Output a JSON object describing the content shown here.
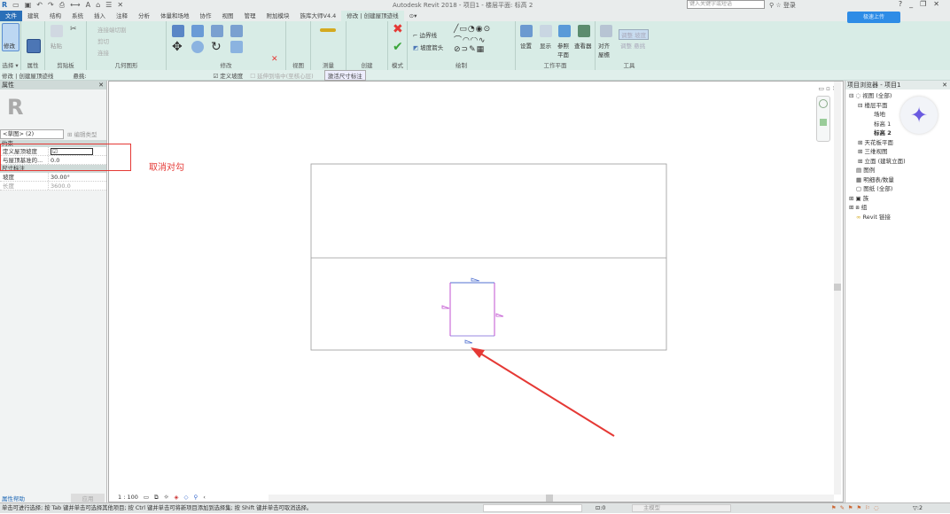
{
  "window": {
    "title": "Autodesk Revit 2018 -   项目1 - 楼层平面: 标高 2",
    "search_placeholder": "键入关键字或短语",
    "login": "登录"
  },
  "tabs": [
    "文件",
    "建筑",
    "结构",
    "系统",
    "插入",
    "注释",
    "分析",
    "体量和场地",
    "协作",
    "视图",
    "管理",
    "附加模块",
    "族库大师V4.4",
    "修改 | 创建屋顶迹线"
  ],
  "active_tab": "修改 | 创建屋顶迹线",
  "ribbon": {
    "panels": [
      "选择 ▾",
      "属性",
      "剪贴板",
      "几何图形",
      "修改",
      "视图",
      "测量",
      "创建",
      "模式",
      "绘制",
      "工作平面",
      "工具"
    ],
    "modify_label": "修改",
    "paste_label": "粘贴",
    "geometry": [
      "连接端切割",
      "剪切",
      "连接"
    ],
    "boundary_line": "边界线",
    "slope_arrow": "坡度箭头",
    "workplane": [
      "设置",
      "显示",
      "参照平面",
      "查看器"
    ],
    "tools": [
      "对齐屋檐",
      "调整 坡度",
      "调整 悬挑"
    ]
  },
  "upload_button": "极速上传",
  "options_bar": {
    "context": "修改 | 创建屋顶迹线",
    "overhang_label": "悬挑:",
    "define_slope": "定义坡度",
    "define_slope_checked": true,
    "extend_to_core": "延伸到墙中(至核心层)",
    "extend_checked": false,
    "activate_dims": "激活尺寸标注"
  },
  "properties": {
    "title": "属性",
    "type_selector": "<草图> (2)",
    "edit_type": "编辑类型",
    "groups": [
      {
        "name": "约束",
        "rows": [
          {
            "key": "定义屋顶坡度",
            "value": "",
            "checked": true
          },
          {
            "key": "与屋顶基准的...",
            "value": "0.0"
          }
        ]
      },
      {
        "name": "尺寸标注",
        "rows": [
          {
            "key": "坡度",
            "value": "30.00°"
          },
          {
            "key": "长度",
            "value": "3600.0"
          }
        ]
      }
    ],
    "help_link": "属性帮助",
    "apply": "应用"
  },
  "annotation": {
    "text": "取消对勾",
    "color": "#e53935"
  },
  "browser": {
    "title": "项目浏览器 - 项目1",
    "items": [
      {
        "label": "视图 (全部)",
        "level": 0
      },
      {
        "label": "楼层平面",
        "level": 1
      },
      {
        "label": "场地",
        "level": 2
      },
      {
        "label": "标高 1",
        "level": 2
      },
      {
        "label": "标高 2",
        "level": 2,
        "selected": true
      },
      {
        "label": "天花板平面",
        "level": 1
      },
      {
        "label": "三维视图",
        "level": 1
      },
      {
        "label": "立面 (建筑立面)",
        "level": 1
      },
      {
        "label": "图例",
        "level": 0
      },
      {
        "label": "明细表/数量",
        "level": 0
      },
      {
        "label": "图纸 (全部)",
        "level": 0
      },
      {
        "label": "族",
        "level": 0
      },
      {
        "label": "组",
        "level": 0
      },
      {
        "label": "Revit 链接",
        "level": 0
      }
    ]
  },
  "view_bar": {
    "scale": "1 : 100"
  },
  "status": {
    "message": "单击可进行选择; 按 Tab 键并单击可选择其他项目; 按 Ctrl 键并单击可将新项目添加到选择集; 按 Shift 键并单击可取消选择。",
    "count": ":0",
    "model": "主模型",
    "filter_count": ":2"
  },
  "colors": {
    "sketch_line": "#c050d0",
    "selected_edge": "#5070d0",
    "arrow": "#e53935",
    "ribbon_bg": "#d8ece6"
  }
}
